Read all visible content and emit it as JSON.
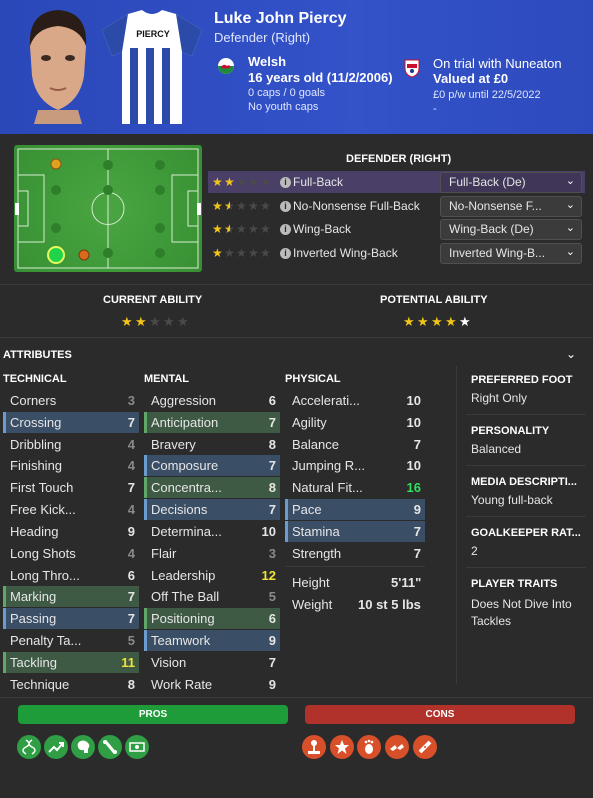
{
  "player": {
    "name": "Luke John Piercy",
    "position": "Defender (Right)",
    "shirt_name": "PIERCY",
    "nationality": "Welsh",
    "age_dob": "16 years old (11/2/2006)",
    "caps_goals": "0 caps / 0 goals",
    "youth_caps": "No youth caps",
    "trial": "On trial with Nuneaton",
    "value": "Valued at £0",
    "wage_contract": "£0 p/w until 22/5/2022",
    "dash": "-"
  },
  "roles": {
    "heading": "DEFENDER (RIGHT)",
    "items": [
      {
        "name": "Full-Back",
        "stars": 2,
        "selected_role": "Full-Back (De)"
      },
      {
        "name": "No-Nonsense Full-Back",
        "stars": 1.5,
        "selected_role": "No-Nonsense F..."
      },
      {
        "name": "Wing-Back",
        "stars": 1.5,
        "selected_role": "Wing-Back (De)"
      },
      {
        "name": "Inverted Wing-Back",
        "stars": 1,
        "selected_role": "Inverted Wing-B..."
      }
    ]
  },
  "ability": {
    "current_label": "CURRENT ABILITY",
    "potential_label": "POTENTIAL ABILITY",
    "current_stars": 2,
    "potential_stars": 4
  },
  "attributes": {
    "heading": "ATTRIBUTES",
    "technical_label": "TECHNICAL",
    "mental_label": "MENTAL",
    "physical_label": "PHYSICAL",
    "technical": [
      {
        "name": "Corners",
        "value": "3"
      },
      {
        "name": "Crossing",
        "value": "7"
      },
      {
        "name": "Dribbling",
        "value": "4"
      },
      {
        "name": "Finishing",
        "value": "4"
      },
      {
        "name": "First Touch",
        "value": "7"
      },
      {
        "name": "Free Kick...",
        "value": "4"
      },
      {
        "name": "Heading",
        "value": "9"
      },
      {
        "name": "Long Shots",
        "value": "4"
      },
      {
        "name": "Long Thro...",
        "value": "6"
      },
      {
        "name": "Marking",
        "value": "7"
      },
      {
        "name": "Passing",
        "value": "7"
      },
      {
        "name": "Penalty Ta...",
        "value": "5"
      },
      {
        "name": "Tackling",
        "value": "11"
      },
      {
        "name": "Technique",
        "value": "8"
      }
    ],
    "mental": [
      {
        "name": "Aggression",
        "value": "6"
      },
      {
        "name": "Anticipation",
        "value": "7"
      },
      {
        "name": "Bravery",
        "value": "8"
      },
      {
        "name": "Composure",
        "value": "7"
      },
      {
        "name": "Concentra...",
        "value": "8"
      },
      {
        "name": "Decisions",
        "value": "7"
      },
      {
        "name": "Determina...",
        "value": "10"
      },
      {
        "name": "Flair",
        "value": "3"
      },
      {
        "name": "Leadership",
        "value": "12"
      },
      {
        "name": "Off The Ball",
        "value": "5"
      },
      {
        "name": "Positioning",
        "value": "6"
      },
      {
        "name": "Teamwork",
        "value": "9"
      },
      {
        "name": "Vision",
        "value": "7"
      },
      {
        "name": "Work Rate",
        "value": "9"
      }
    ],
    "physical": [
      {
        "name": "Accelerati...",
        "value": "10"
      },
      {
        "name": "Agility",
        "value": "10"
      },
      {
        "name": "Balance",
        "value": "7"
      },
      {
        "name": "Jumping R...",
        "value": "10"
      },
      {
        "name": "Natural Fit...",
        "value": "16"
      },
      {
        "name": "Pace",
        "value": "9"
      },
      {
        "name": "Stamina",
        "value": "7"
      },
      {
        "name": "Strength",
        "value": "7"
      }
    ],
    "height_label": "Height",
    "height_value": "5'11\"",
    "weight_label": "Weight",
    "weight_value": "10 st 5 lbs"
  },
  "side": {
    "foot_label": "PREFERRED FOOT",
    "foot_value": "Right Only",
    "personality_label": "PERSONALITY",
    "personality_value": "Balanced",
    "media_label": "MEDIA DESCRIPTI...",
    "media_value": "Young full-back",
    "gk_label": "GOALKEEPER RAT...",
    "gk_value": "2",
    "traits_label": "PLAYER TRAITS",
    "traits_value_1": "Does Not Dive Into",
    "traits_value_2": "Tackles"
  },
  "footer": {
    "pros_label": "PROS",
    "cons_label": "CONS",
    "pros_icons": [
      "dna-icon",
      "trend-up-icon",
      "brain-icon",
      "bone-icon",
      "money-icon"
    ],
    "cons_icons": [
      "joystick-icon",
      "star-icon",
      "foot-icon",
      "boots-icon",
      "bandage-icon"
    ]
  },
  "colors": {
    "header_blue": "#3452c9",
    "pros_green": "#1f9c3a",
    "cons_red": "#b0322b",
    "star_gold": "#f0c419"
  }
}
